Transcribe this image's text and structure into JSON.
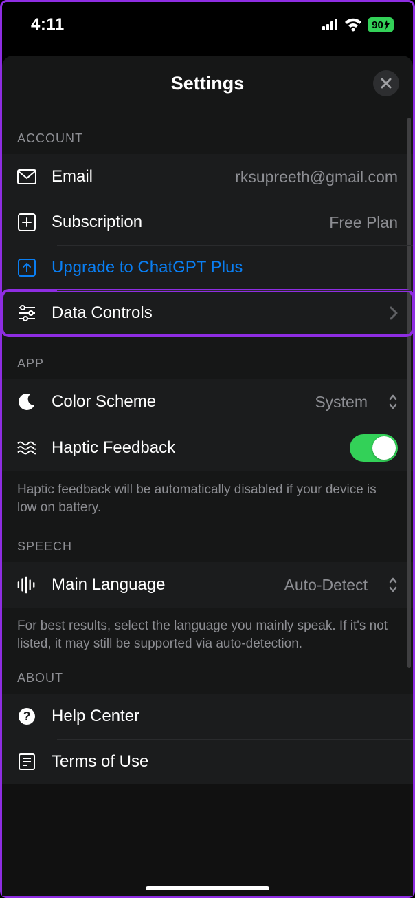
{
  "status": {
    "time": "4:11",
    "battery": "90"
  },
  "header": {
    "title": "Settings"
  },
  "sections": {
    "account": {
      "label": "ACCOUNT",
      "email": {
        "label": "Email",
        "value": "rksupreeth@gmail.com"
      },
      "subscription": {
        "label": "Subscription",
        "value": "Free Plan"
      },
      "upgrade": {
        "label": "Upgrade to ChatGPT Plus"
      },
      "data_controls": {
        "label": "Data Controls"
      }
    },
    "app": {
      "label": "APP",
      "color_scheme": {
        "label": "Color Scheme",
        "value": "System"
      },
      "haptic": {
        "label": "Haptic Feedback",
        "on": true
      },
      "haptic_note": "Haptic feedback will be automatically disabled if your device is low on battery."
    },
    "speech": {
      "label": "SPEECH",
      "main_language": {
        "label": "Main Language",
        "value": "Auto-Detect"
      },
      "note": "For best results, select the language you mainly speak. If it's not listed, it may still be supported via auto-detection."
    },
    "about": {
      "label": "ABOUT",
      "help_center": {
        "label": "Help Center"
      },
      "terms": {
        "label": "Terms of Use"
      }
    }
  }
}
